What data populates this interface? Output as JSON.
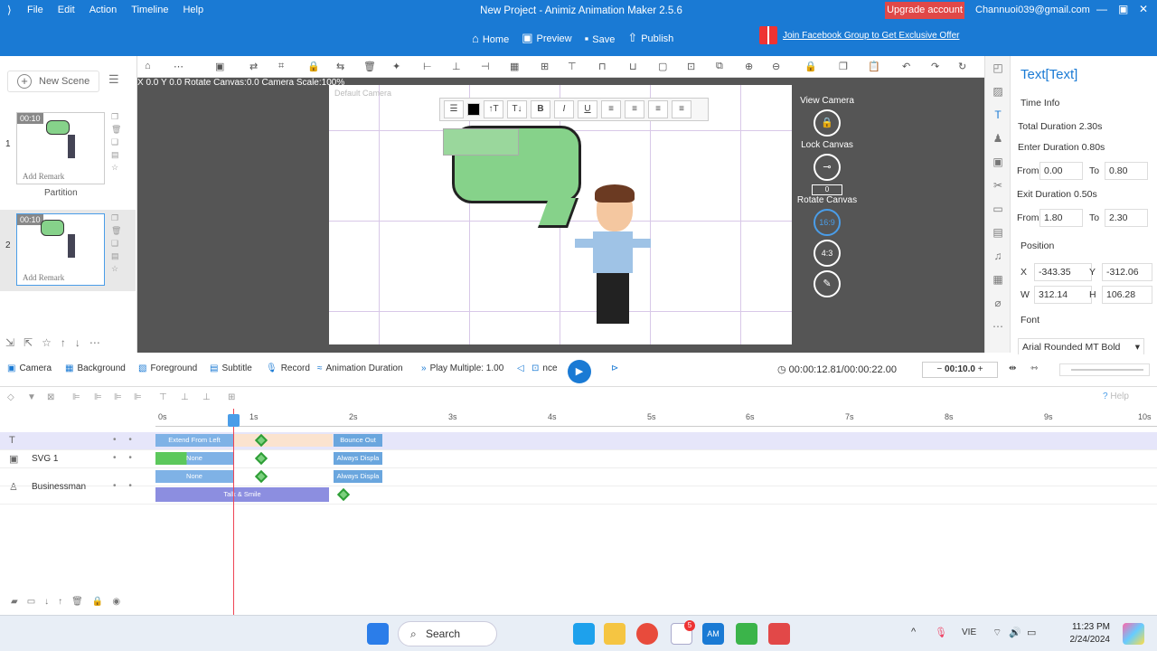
{
  "app": {
    "title": "New Project - Animiz Animation Maker 2.5.6",
    "upgrade": "Upgrade account",
    "email": "Channuoi039@gmail.com",
    "menu": [
      "File",
      "Edit",
      "Action",
      "Timeline",
      "Help"
    ]
  },
  "toolbar": {
    "home": "Home",
    "preview": "Preview",
    "save": "Save",
    "publish": "Publish",
    "promo": "Join Facebook Group to Get Exclusive Offer"
  },
  "scenes": {
    "new_scene": "New Scene",
    "items": [
      {
        "num": "1",
        "time": "00:10",
        "remark": "Add Remark"
      },
      {
        "num": "2",
        "time": "00:10",
        "remark": "Add Remark"
      }
    ],
    "partition": "Partition"
  },
  "canvas": {
    "coords": "X 0.0 Y 0.0 Rotate Canvas:0.0 Camera Scale:100%",
    "default_camera": "Default Camera",
    "view_camera": "View Camera",
    "lock_canvas": "Lock Canvas",
    "rotate_canvas": "Rotate Canvas",
    "rotate_value": "0",
    "ratio_169": "16:9",
    "ratio_43": "4:3"
  },
  "props": {
    "title": "Text[Text]",
    "time_info": "Time Info",
    "total_duration": "Total Duration  2.30s",
    "enter_duration": "Enter Duration  0.80s",
    "from": "From",
    "to": "To",
    "enter_from": "0.00",
    "enter_to": "0.80",
    "exit_duration": "Exit Duration  0.50s",
    "exit_from": "1.80",
    "exit_to": "2.30",
    "position": "Position",
    "x_label": "X",
    "x": "-343.35",
    "y_label": "Y",
    "y": "-312.06",
    "w_label": "W",
    "w": "312.14",
    "h_label": "H",
    "h": "106.28",
    "font": "Font",
    "font_name": "Arial Rounded MT Bold"
  },
  "transport": {
    "camera": "Camera",
    "background": "Background",
    "foreground": "Foreground",
    "subtitle": "Subtitle",
    "record": "Record",
    "anim_duration": "Animation Duration",
    "play_multiple": "Play Multiple: 1.00",
    "nce": "nce",
    "time": "00:00:12.81/00:00:22.00",
    "zoom": "00:10.0",
    "help": "Help"
  },
  "timeline": {
    "ruler": [
      "0s",
      "1s",
      "2s",
      "3s",
      "4s",
      "5s",
      "6s",
      "7s",
      "8s",
      "9s",
      "10s"
    ],
    "tracks": [
      {
        "name": "",
        "enter": "Extend From Left",
        "exit": "Bounce Out"
      },
      {
        "name": "SVG 1",
        "enter": "None",
        "exit": "Always Displa"
      },
      {
        "name": "",
        "enter": "None",
        "exit": "Always Displa"
      },
      {
        "name": "Businessman",
        "enter": "Talk & Smile",
        "exit": ""
      }
    ]
  },
  "taskbar": {
    "search": "Search",
    "lang": "VIE",
    "time": "11:23 PM",
    "date": "2/24/2024",
    "badge": "5"
  }
}
